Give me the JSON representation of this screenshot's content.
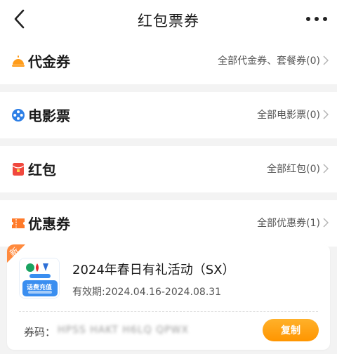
{
  "header": {
    "title": "红包票券"
  },
  "sections": {
    "voucher": {
      "title": "代金券",
      "link": "全部代金券、套餐券(0)"
    },
    "movie": {
      "title": "电影票",
      "link": "全部电影票(0)"
    },
    "redpacket": {
      "title": "红包",
      "link": "全部红包(0)"
    },
    "coupon": {
      "title": "优惠券",
      "link": "全部优惠券(1)"
    }
  },
  "coupon_card": {
    "badge": "新",
    "thumb_text": "话费充值",
    "name": "2024年春日有礼活动（SX）",
    "validity": "有效期:2024.04.16-2024.08.31",
    "code_label": "券码：",
    "code_value": "HPSS HAKT H6LQ QPWX",
    "copy_label": "复制"
  },
  "colors": {
    "accent": "#ff9a00",
    "voucher_icon": "#ff9c1a",
    "movie_icon": "#2d7fe6",
    "redpacket_icon": "#f0483e",
    "coupon_icon": "#ff7a29"
  },
  "icons": {
    "back": "chevron-left-icon",
    "more": "more-dots-icon",
    "voucher": "food-cloche-icon",
    "movie": "film-reel-icon",
    "redpacket": "red-envelope-icon",
    "coupon": "ticket-icon"
  }
}
